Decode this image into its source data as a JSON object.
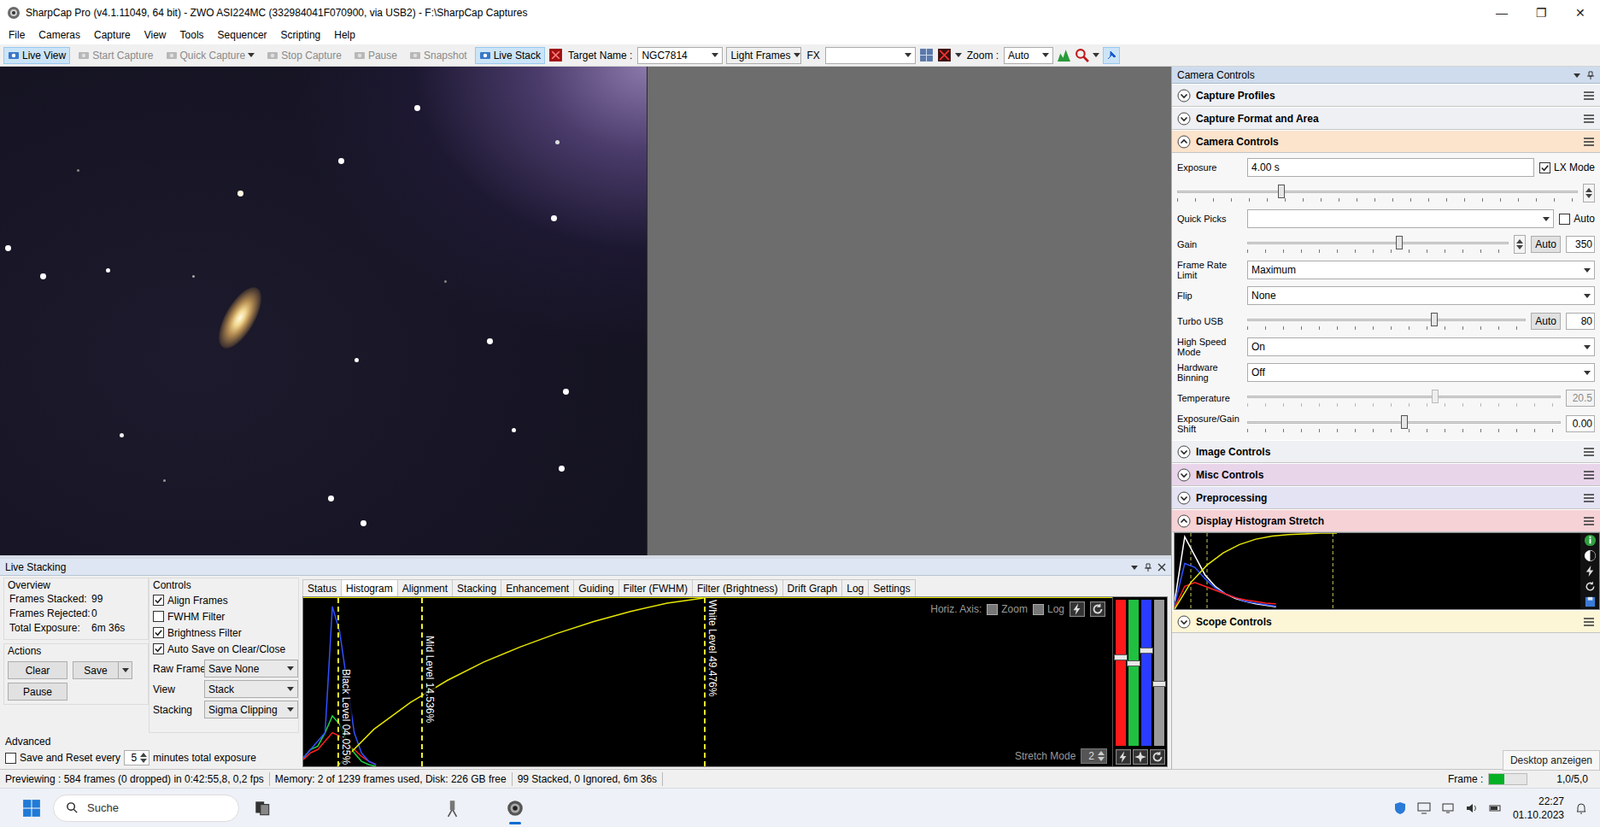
{
  "window": {
    "title": "SharpCap Pro (v4.1.11049, 64 bit) - ZWO ASI224MC (332984041F070900, via USB2) - F:\\SharpCap Captures",
    "controls": [
      "—",
      "❐",
      "✕"
    ]
  },
  "menu": [
    "File",
    "Cameras",
    "Capture",
    "View",
    "Tools",
    "Sequencer",
    "Scripting",
    "Help"
  ],
  "toolbar": {
    "buttons": [
      {
        "label": "Live View",
        "active": true,
        "disabled": false,
        "dropdown": false
      },
      {
        "label": "Start Capture",
        "active": false,
        "disabled": true,
        "dropdown": false
      },
      {
        "label": "Quick Capture",
        "active": false,
        "disabled": true,
        "dropdown": true
      },
      {
        "label": "Stop Capture",
        "active": false,
        "disabled": true,
        "dropdown": false
      },
      {
        "label": "Pause",
        "active": false,
        "disabled": true,
        "dropdown": false
      },
      {
        "label": "Snapshot",
        "active": false,
        "disabled": true,
        "dropdown": false
      },
      {
        "label": "Live Stack",
        "active": true,
        "disabled": false,
        "dropdown": false
      }
    ],
    "target_label": "Target Name :",
    "target": "NGC7814",
    "frame_type": "Light Frames",
    "fx_label": "FX",
    "fx": "",
    "zoom_label": "Zoom :",
    "zoom": "Auto"
  },
  "camera_panel": {
    "title": "Camera Controls",
    "sections": [
      {
        "title": "Capture Profiles",
        "expanded": false,
        "color": "#eef0f4"
      },
      {
        "title": "Capture Format and Area",
        "expanded": false,
        "color": "#eef0f4"
      },
      {
        "title": "Camera Controls",
        "expanded": true,
        "color": "#fbe3cc",
        "rows": [
          {
            "kind": "field",
            "label": "Exposure",
            "value": "4.00 s",
            "check": {
              "label": "LX Mode",
              "checked": true
            }
          },
          {
            "kind": "track",
            "level": 0.26
          },
          {
            "kind": "select",
            "label": "Quick Picks",
            "value": "",
            "check": {
              "label": "Auto",
              "checked": false
            }
          },
          {
            "kind": "slider",
            "label": "Gain",
            "level": 0.58,
            "spin": true,
            "auto": "Auto",
            "value": "350",
            "disabled": false
          },
          {
            "kind": "select",
            "label": "Frame Rate Limit",
            "value": "Maximum"
          },
          {
            "kind": "select",
            "label": "Flip",
            "value": "None"
          },
          {
            "kind": "slider",
            "label": "Turbo USB",
            "level": 0.67,
            "spin": false,
            "auto": "Auto",
            "value": "80",
            "disabled": false
          },
          {
            "kind": "select",
            "label": "High Speed Mode",
            "value": "On"
          },
          {
            "kind": "select",
            "label": "Hardware Binning",
            "value": "Off"
          },
          {
            "kind": "slider",
            "label": "Temperature",
            "level": 0.6,
            "spin": false,
            "auto": "",
            "value": "20.5",
            "disabled": true
          },
          {
            "kind": "slider",
            "label": "Exposure/Gain Shift",
            "level": 0.5,
            "spin": false,
            "auto": "",
            "value": "0.00",
            "disabled": false
          }
        ]
      },
      {
        "title": "Image Controls",
        "expanded": false,
        "color": "#eef0f4"
      },
      {
        "title": "Misc Controls",
        "expanded": false,
        "color": "#e9d5ea"
      },
      {
        "title": "Preprocessing",
        "expanded": false,
        "color": "#e3e3f3"
      },
      {
        "title": "Display Histogram Stretch",
        "expanded": true,
        "color": "#f6d2d6",
        "chart": {
          "curve": [
            0,
            0.35,
            0.58,
            0.74,
            0.85,
            0.92,
            0.96,
            0.98,
            0.99,
            1,
            1
          ],
          "markers": [
            0.04,
            0.08,
            0.39
          ],
          "series": [
            {
              "name": "white",
              "color": "#ffffff",
              "values": [
                0.1,
                0.95,
                0.7,
                0.45,
                0.3,
                0.2,
                0.14,
                0.1,
                0.07,
                0.05,
                0.03
              ]
            },
            {
              "name": "blue",
              "color": "#3050ff",
              "values": [
                0.05,
                0.6,
                0.55,
                0.4,
                0.28,
                0.2,
                0.15,
                0.1,
                0.08,
                0.06,
                0.04
              ]
            },
            {
              "name": "red",
              "color": "#ff2020",
              "values": [
                0.02,
                0.3,
                0.35,
                0.3,
                0.25,
                0.2,
                0.15,
                0.12,
                0.1,
                0.08,
                0.07
              ]
            }
          ]
        }
      },
      {
        "title": "Scope Controls",
        "expanded": false,
        "color": "#fcf5d6"
      }
    ]
  },
  "live": {
    "title": "Live Stacking",
    "overview": {
      "title": "Overview",
      "stats": [
        {
          "label": "Frames Stacked:",
          "value": "99"
        },
        {
          "label": "Frames Rejected:",
          "value": "0"
        },
        {
          "label": "Total Exposure:",
          "value": "6m 36s"
        }
      ]
    },
    "actions": {
      "title": "Actions",
      "clear": "Clear",
      "save": "Save",
      "pause": "Pause"
    },
    "advanced": {
      "title": "Advanced",
      "label": "Save and Reset every",
      "checked": false,
      "value": "5",
      "suffix": "minutes total exposure"
    },
    "controls": {
      "title": "Controls",
      "checks": [
        {
          "label": "Align Frames",
          "checked": true
        },
        {
          "label": "FWHM Filter",
          "checked": false
        },
        {
          "label": "Brightness Filter",
          "checked": true
        },
        {
          "label": "Auto Save on Clear/Close",
          "checked": true
        }
      ],
      "selects": [
        {
          "label": "Raw Frames",
          "value": "Save None"
        },
        {
          "label": "View",
          "value": "Stack"
        },
        {
          "label": "Stacking",
          "value": "Sigma Clipping"
        }
      ]
    },
    "tabs": [
      {
        "label": "Status",
        "selected": false
      },
      {
        "label": "Histogram",
        "selected": true
      },
      {
        "label": "Alignment",
        "selected": false
      },
      {
        "label": "Stacking",
        "selected": false
      },
      {
        "label": "Enhancement",
        "selected": false
      },
      {
        "label": "Guiding",
        "selected": false
      },
      {
        "label": "Filter (FWHM)",
        "selected": false
      },
      {
        "label": "Filter (Brightness)",
        "selected": false
      },
      {
        "label": "Drift Graph",
        "selected": false
      },
      {
        "label": "Log",
        "selected": false
      },
      {
        "label": "Settings",
        "selected": false
      }
    ],
    "histogram": {
      "axis_label": "Horiz. Axis:",
      "options": [
        {
          "label": "Zoom",
          "checked": false
        },
        {
          "label": "Log",
          "checked": false
        }
      ],
      "levels": [
        {
          "label": "Black Level 04.025%",
          "level": 0.042
        },
        {
          "label": "Mid Level 14.536%",
          "level": 0.146
        },
        {
          "label": "White Level 49.476%",
          "level": 0.495
        }
      ],
      "curve": [
        0,
        0.22,
        0.38,
        0.51,
        0.62,
        0.71,
        0.79,
        0.86,
        0.92,
        0.97,
        1
      ],
      "series": [
        {
          "name": "red",
          "color": "#ff2020",
          "values": [
            0.04,
            0.08,
            0.1,
            0.15,
            0.2,
            0.18,
            0.12,
            0.1,
            0.06,
            0.03,
            0.01
          ]
        },
        {
          "name": "green",
          "color": "#20d040",
          "values": [
            0.05,
            0.1,
            0.12,
            0.2,
            0.3,
            0.25,
            0.15,
            0.08,
            0.03,
            0.01,
            0
          ]
        },
        {
          "name": "blue",
          "color": "#3050ff",
          "values": [
            0.05,
            0.1,
            0.15,
            0.2,
            0.95,
            0.8,
            0.5,
            0.2,
            0.08,
            0.03,
            0.01
          ]
        }
      ],
      "channels": [
        {
          "name": "red",
          "color": "#ff1a1a",
          "level": 0.6
        },
        {
          "name": "green",
          "color": "#20c040",
          "level": 0.56
        },
        {
          "name": "blue",
          "color": "#2a3cff",
          "level": 0.65
        },
        {
          "name": "luminance",
          "color": "#9a9a9a",
          "level": 0.42
        }
      ],
      "stretch_label": "Stretch Mode",
      "stretch_value": "2"
    }
  },
  "status_bar": {
    "segments": [
      "Previewing : 584 frames (0 dropped) in 0:42:55,8, 0,2 fps",
      "Memory: 2 of 1239 frames used, Disk: 226 GB free",
      "99 Stacked, 0 Ignored, 6m 36s"
    ],
    "frame_label": "Frame :",
    "frame_level": 0.4,
    "frame_value": "1,0/5,0"
  },
  "taskbar": {
    "search": "Suche",
    "time": "22:27",
    "date": "01.10.2023",
    "tooltip": "Desktop anzeigen"
  }
}
